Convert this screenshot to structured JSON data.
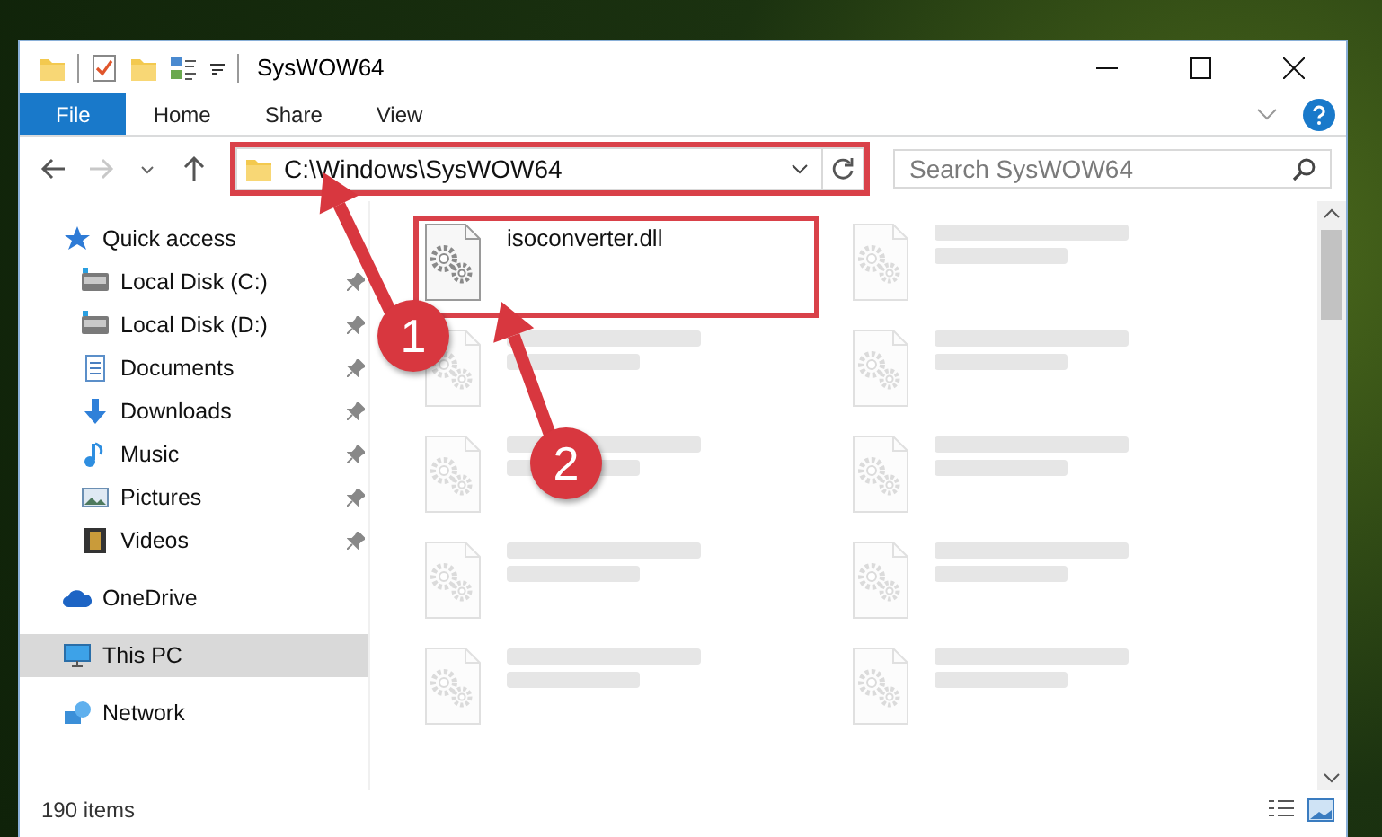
{
  "window": {
    "title": "SysWOW64"
  },
  "ribbon": {
    "tabs": [
      {
        "label": "File",
        "selected": true
      },
      {
        "label": "Home",
        "selected": false
      },
      {
        "label": "Share",
        "selected": false
      },
      {
        "label": "View",
        "selected": false
      }
    ]
  },
  "address": {
    "path": "C:\\Windows\\SysWOW64",
    "highlighted": true
  },
  "search": {
    "placeholder": "Search SysWOW64"
  },
  "sidebar": {
    "items": [
      {
        "label": "Quick access",
        "kind": "star",
        "selected": false,
        "children": [
          {
            "label": "Local Disk (C:)",
            "kind": "drive",
            "pinned": true,
            "selected": false
          },
          {
            "label": "Local Disk (D:)",
            "kind": "drive",
            "pinned": true,
            "selected": false
          },
          {
            "label": "Documents",
            "kind": "documents",
            "pinned": true,
            "selected": false
          },
          {
            "label": "Downloads",
            "kind": "downloads",
            "pinned": true,
            "selected": false
          },
          {
            "label": "Music",
            "kind": "music",
            "pinned": true,
            "selected": false
          },
          {
            "label": "Pictures",
            "kind": "pictures",
            "pinned": true,
            "selected": false
          },
          {
            "label": "Videos",
            "kind": "videos",
            "pinned": true,
            "selected": false
          }
        ]
      },
      {
        "label": "OneDrive",
        "kind": "cloud",
        "selected": false
      },
      {
        "label": "This PC",
        "kind": "computer",
        "selected": true
      },
      {
        "label": "Network",
        "kind": "network",
        "selected": false
      }
    ]
  },
  "files": [
    {
      "name": "isoconverter.dll",
      "highlighted": true,
      "dimmed": false
    },
    {
      "highlighted": false,
      "dimmed": true
    },
    {
      "highlighted": false,
      "dimmed": true
    },
    {
      "highlighted": false,
      "dimmed": true
    },
    {
      "highlighted": false,
      "dimmed": true
    },
    {
      "highlighted": false,
      "dimmed": true
    },
    {
      "highlighted": false,
      "dimmed": true
    },
    {
      "highlighted": false,
      "dimmed": true
    },
    {
      "highlighted": false,
      "dimmed": true
    },
    {
      "highlighted": false,
      "dimmed": true
    }
  ],
  "status_bar": {
    "item_count": "190 items"
  },
  "annotations": [
    {
      "label": "1"
    },
    {
      "label": "2"
    }
  ]
}
